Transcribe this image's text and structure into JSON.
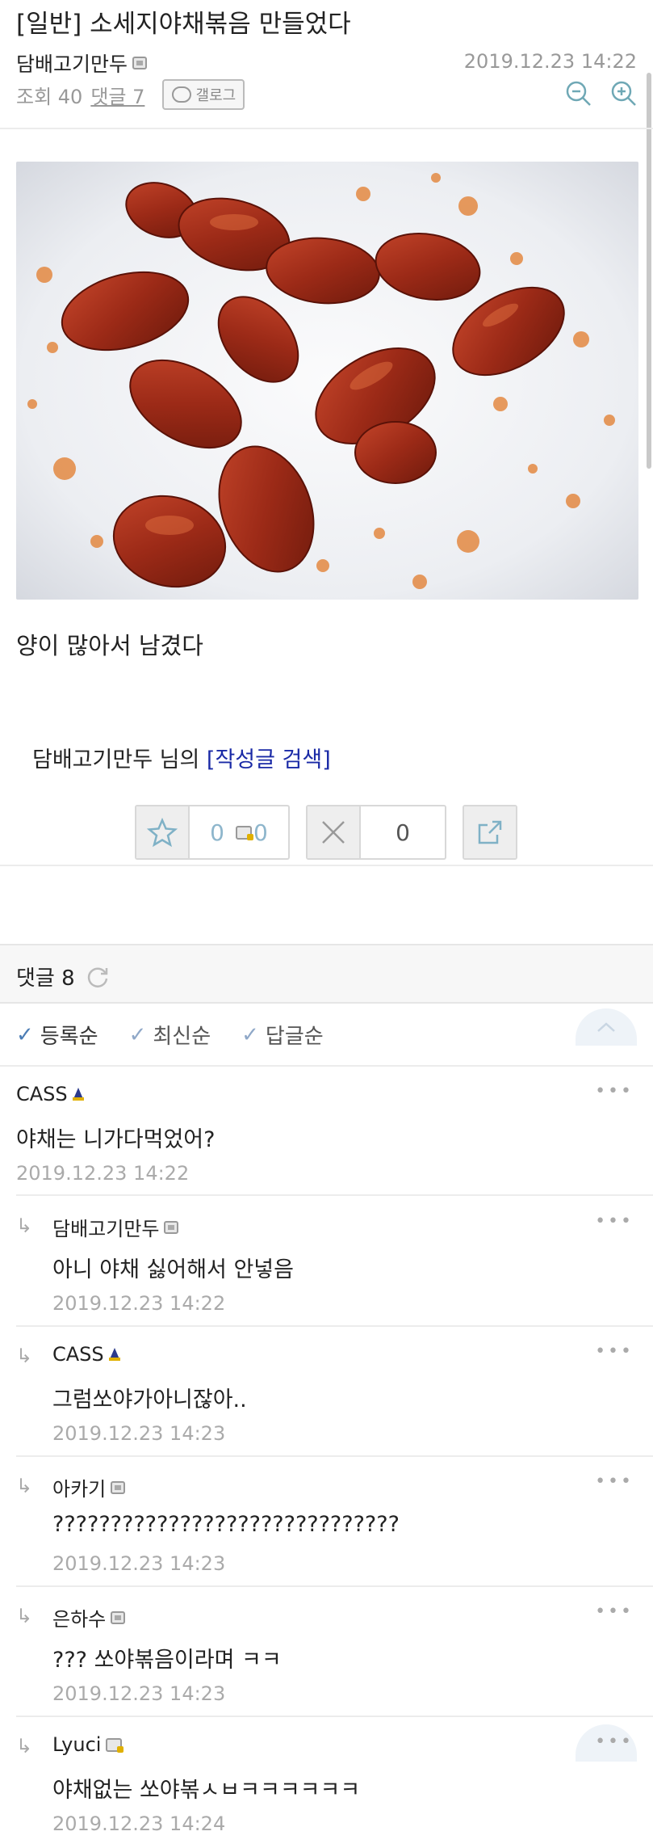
{
  "post": {
    "title": "[일반] 소세지야채볶음 만들었다",
    "author": "담배고기만두",
    "date": "2019.12.23 14:22",
    "views_label": "조회 40",
    "comments_label": "댓글 7",
    "gallog_label": "갤로그",
    "body": "양이 많아서 남겼다",
    "search_prefix": "담배고기만두 님의",
    "search_link": "[작성글 검색]"
  },
  "votes": {
    "recommend_count": "0",
    "fixed_recommend_count": "0",
    "downvote_count": "0"
  },
  "comments_section": {
    "header_label": "댓글 8",
    "sort_options": [
      "등록순",
      "최신순",
      "답글순"
    ]
  },
  "comments": [
    {
      "name": "CASS",
      "badge": "manager",
      "text": "야채는 니가다먹었어?",
      "date": "2019.12.23 14:22",
      "reply": false
    },
    {
      "name": "담배고기만두",
      "badge": "fixed",
      "text": "아니 야채 싫어해서 안넣음",
      "date": "2019.12.23 14:22",
      "reply": true
    },
    {
      "name": "CASS",
      "badge": "manager",
      "text": "그럼쏘야가아니잖아..",
      "date": "2019.12.23 14:23",
      "reply": true
    },
    {
      "name": "아카기",
      "badge": "fixed",
      "text": "??????????????????????????????",
      "date": "2019.12.23 14:23",
      "reply": true
    },
    {
      "name": "은하수",
      "badge": "fixed",
      "text": "??? 쏘야볶음이라며 ㅋㅋ",
      "date": "2019.12.23 14:23",
      "reply": true
    },
    {
      "name": "Lyuci",
      "badge": "fixed-gold",
      "text": "야채없는 쏘야볶ㅅㅂㅋㅋㅋㅋㅋㅋ",
      "date": "2019.12.23 14:24",
      "reply": true
    }
  ],
  "icons": {
    "zoom_out": "zoom-out-icon",
    "zoom_in": "zoom-in-icon",
    "recommend": "star-icon",
    "downvote": "x-icon",
    "share": "share-icon",
    "refresh": "refresh-icon"
  },
  "colors": {
    "accent_teal": "#6fa8b5",
    "link_blue": "#1a2aa6",
    "check_blue": "#4c7db5"
  }
}
